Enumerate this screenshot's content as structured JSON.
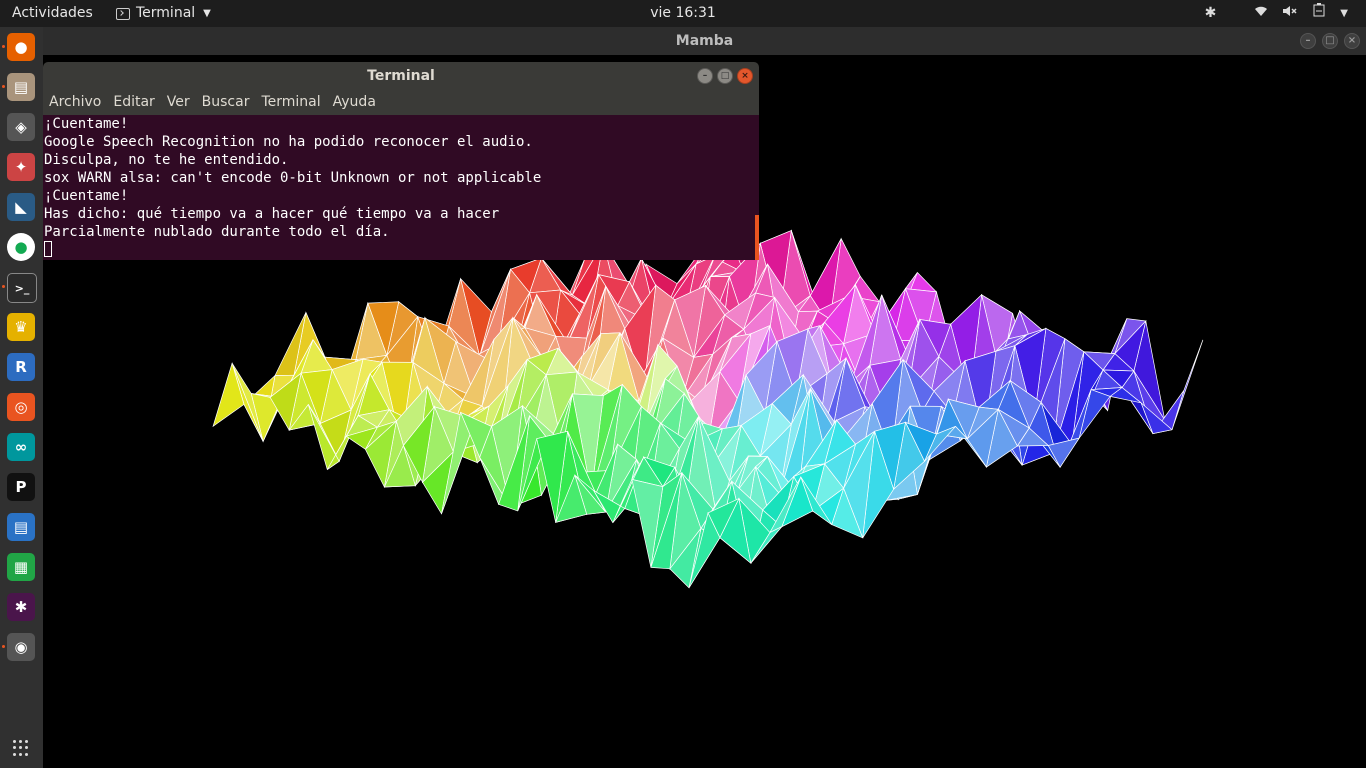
{
  "topbar": {
    "activities": "Actividades",
    "app_menu": "Terminal",
    "clock": "vie 16:31"
  },
  "dock": {
    "items": [
      {
        "name": "firefox-icon",
        "color": "#e66000",
        "glyph": "●",
        "running": true
      },
      {
        "name": "files-icon",
        "color": "#a9947c",
        "glyph": "▤",
        "running": true
      },
      {
        "name": "games-icon",
        "color": "#555555",
        "glyph": "◈",
        "running": false
      },
      {
        "name": "settings-tool-icon",
        "color": "#c44",
        "glyph": "✦",
        "running": false
      },
      {
        "name": "mysql-workbench-icon",
        "color": "#2a5b85",
        "glyph": "◣",
        "running": false
      },
      {
        "name": "mongodb-compass-icon",
        "color": "#ffffff",
        "glyph": "●",
        "running": false
      },
      {
        "name": "terminal-icon",
        "color": "#2b2b2b",
        "glyph": ">_",
        "running": true
      },
      {
        "name": "trophy-app-icon",
        "color": "#e5b100",
        "glyph": "♛",
        "running": false
      },
      {
        "name": "r-icon",
        "color": "#2d6cc0",
        "glyph": "R",
        "running": false
      },
      {
        "name": "ubuntu-software-icon",
        "color": "#e95420",
        "glyph": "◎",
        "running": false
      },
      {
        "name": "arduino-icon",
        "color": "#00979d",
        "glyph": "∞",
        "running": false
      },
      {
        "name": "pycharm-icon",
        "color": "#111111",
        "glyph": "P",
        "running": false
      },
      {
        "name": "libreoffice-writer-icon",
        "color": "#2a72c5",
        "glyph": "▤",
        "running": false
      },
      {
        "name": "libreoffice-calc-icon",
        "color": "#21a546",
        "glyph": "▦",
        "running": false
      },
      {
        "name": "slack-icon",
        "color": "#4a154b",
        "glyph": "✱",
        "running": false
      },
      {
        "name": "screen-recorder-icon",
        "color": "#555555",
        "glyph": "◉",
        "running": true
      }
    ]
  },
  "mamba_window": {
    "title": "Mamba"
  },
  "terminal": {
    "title": "Terminal",
    "menu": [
      "Archivo",
      "Editar",
      "Ver",
      "Buscar",
      "Terminal",
      "Ayuda"
    ],
    "lines": [
      "¡Cuentame!",
      "Google Speech Recognition no ha podido reconocer el audio.",
      "Disculpa, no te he entendido.",
      "sox WARN alsa: can't encode 0-bit Unknown or not applicable",
      "¡Cuentame!",
      "Has dicho: qué tiempo va a hacer qué tiempo va a hacer",
      "Parcialmente nublado durante todo el día."
    ]
  },
  "colors": {
    "terminal_bg": "#300a24",
    "accent": "#e95420",
    "desktop_bg": "#000000"
  }
}
